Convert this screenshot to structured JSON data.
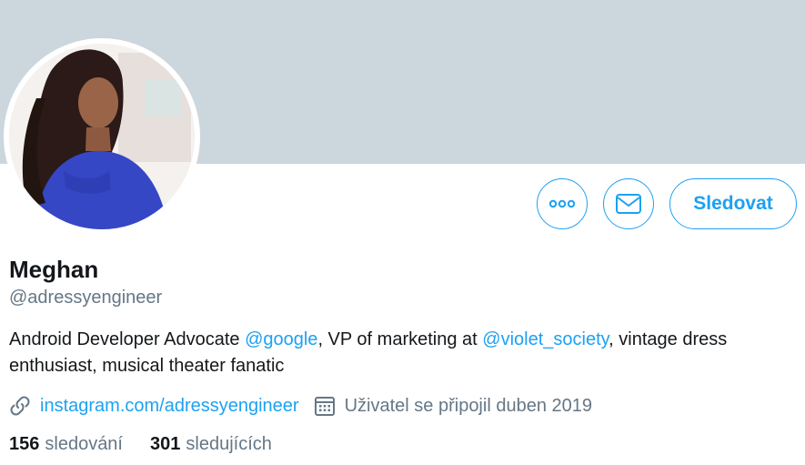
{
  "profile": {
    "name": "Meghan",
    "handle": "@adressyengineer",
    "bio": {
      "text_1": "Android Developer Advocate ",
      "mention_1": "@google",
      "text_2": ", VP of marketing at ",
      "mention_2": "@violet_society",
      "text_3": ", vintage dress enthusiast, musical theater fanatic"
    },
    "website": "instagram.com/adressyengineer",
    "joined": "Uživatel se připojil duben 2019",
    "following_count": "156",
    "following_label": "sledování",
    "followers_count": "301",
    "followers_label": "sledujících"
  },
  "actions": {
    "follow_label": "Sledovat",
    "more_icon": "more-horizontal-icon",
    "message_icon": "envelope-icon"
  },
  "icons": {
    "website": "link-icon",
    "joined": "calendar-icon"
  },
  "colors": {
    "accent": "#1da1f2",
    "banner": "#ccd6dd",
    "secondary_text": "#657786",
    "primary_text": "#14171a"
  }
}
